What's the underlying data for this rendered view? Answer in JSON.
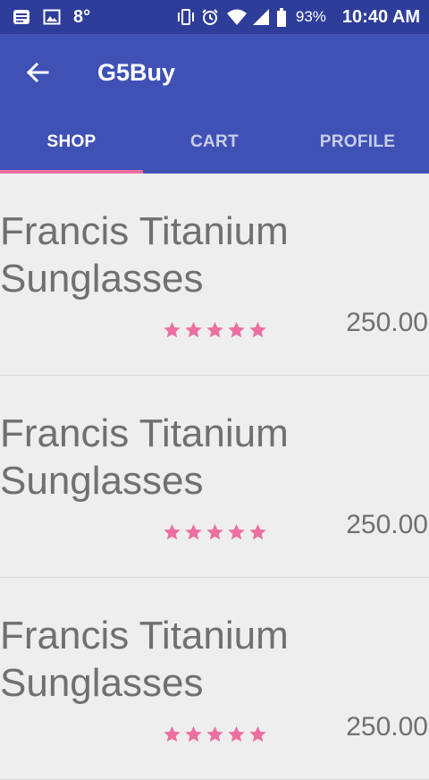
{
  "status_bar": {
    "notification_icons": [
      "message-icon",
      "image-icon"
    ],
    "temperature": "8°",
    "battery_percent": "93%",
    "time": "10:40 AM"
  },
  "app_bar": {
    "title": "G5Buy"
  },
  "tabs": [
    {
      "label": "SHOP",
      "active": true
    },
    {
      "label": "CART",
      "active": false
    },
    {
      "label": "PROFILE",
      "active": false
    }
  ],
  "colors": {
    "primary": "#3f51b5",
    "primary_dark": "#2e3d9a",
    "accent": "#ec6fa0",
    "background": "#eeeeee",
    "text": "#707070"
  },
  "products": [
    {
      "name": "Francis Titanium Sunglasses",
      "rating": 5,
      "rating_max": 5,
      "price": "250.00"
    },
    {
      "name": "Francis Titanium Sunglasses",
      "rating": 5,
      "rating_max": 5,
      "price": "250.00"
    },
    {
      "name": "Francis Titanium Sunglasses",
      "rating": 5,
      "rating_max": 5,
      "price": "250.00"
    }
  ]
}
